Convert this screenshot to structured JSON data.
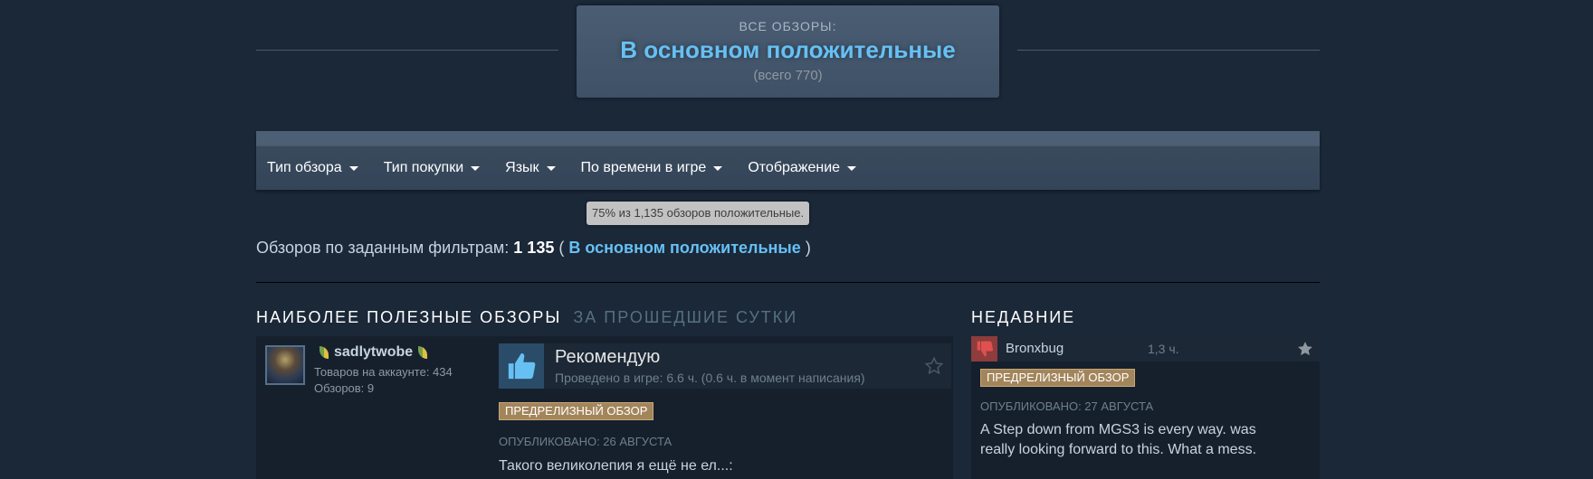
{
  "summary": {
    "label": "ВСЕ ОБЗОРЫ:",
    "rating": "В основном положительные",
    "count": "(всего 770)"
  },
  "filters": [
    {
      "label": "Тип обзора"
    },
    {
      "label": "Тип покупки"
    },
    {
      "label": "Язык"
    },
    {
      "label": "По времени в игре"
    },
    {
      "label": "Отображение"
    }
  ],
  "tooltip": "75% из 1,135 обзоров положительные.",
  "filter_summary": {
    "prefix": "Обзоров по заданным фильтрам:",
    "count": "1 135",
    "open": "(",
    "rating": "В основном положительные",
    "close": ")"
  },
  "helpful": {
    "title": "НАИБОЛЕЕ ПОЛЕЗНЫЕ ОБЗОРЫ",
    "subtitle": "ЗА ПРОШЕДШИЕ СУТКИ"
  },
  "review": {
    "author": "sadlytwobe",
    "products": "Товаров на аккаунте: 434",
    "reviews": "Обзоров: 9",
    "verdict": "Рекомендую",
    "hours": "Проведено в игре: 6.6 ч. (0.6 ч. в момент написания)",
    "badge": "ПРЕДРЕЛИЗНЫЙ ОБЗОР",
    "posted": "ОПУБЛИКОВАНО: 26 АВГУСТА",
    "text": "Такого великолепия я ещё не ел...:"
  },
  "recent": {
    "title": "НЕДАВНИЕ",
    "author": "Bronxbug",
    "hours": "1,3 ч.",
    "badge": "ПРЕДРЕЛИЗНЫЙ ОБЗОР",
    "posted": "ОПУБЛИКОВАНО: 27 АВГУСТА",
    "text_line1": "A Step down from MGS3 is every way. was",
    "text_line2": "really looking forward to this. What a mess."
  },
  "colors": {
    "background": "#1b2838",
    "accent": "#66c0f4",
    "positive": "#66c0f4",
    "negative": "#8e3c3c",
    "badge": "#a3855b"
  },
  "icons": {
    "thumbs_up": "thumbs-up-icon",
    "thumbs_down": "thumbs-down-icon",
    "star": "star-icon",
    "caret": "caret-down-icon"
  }
}
